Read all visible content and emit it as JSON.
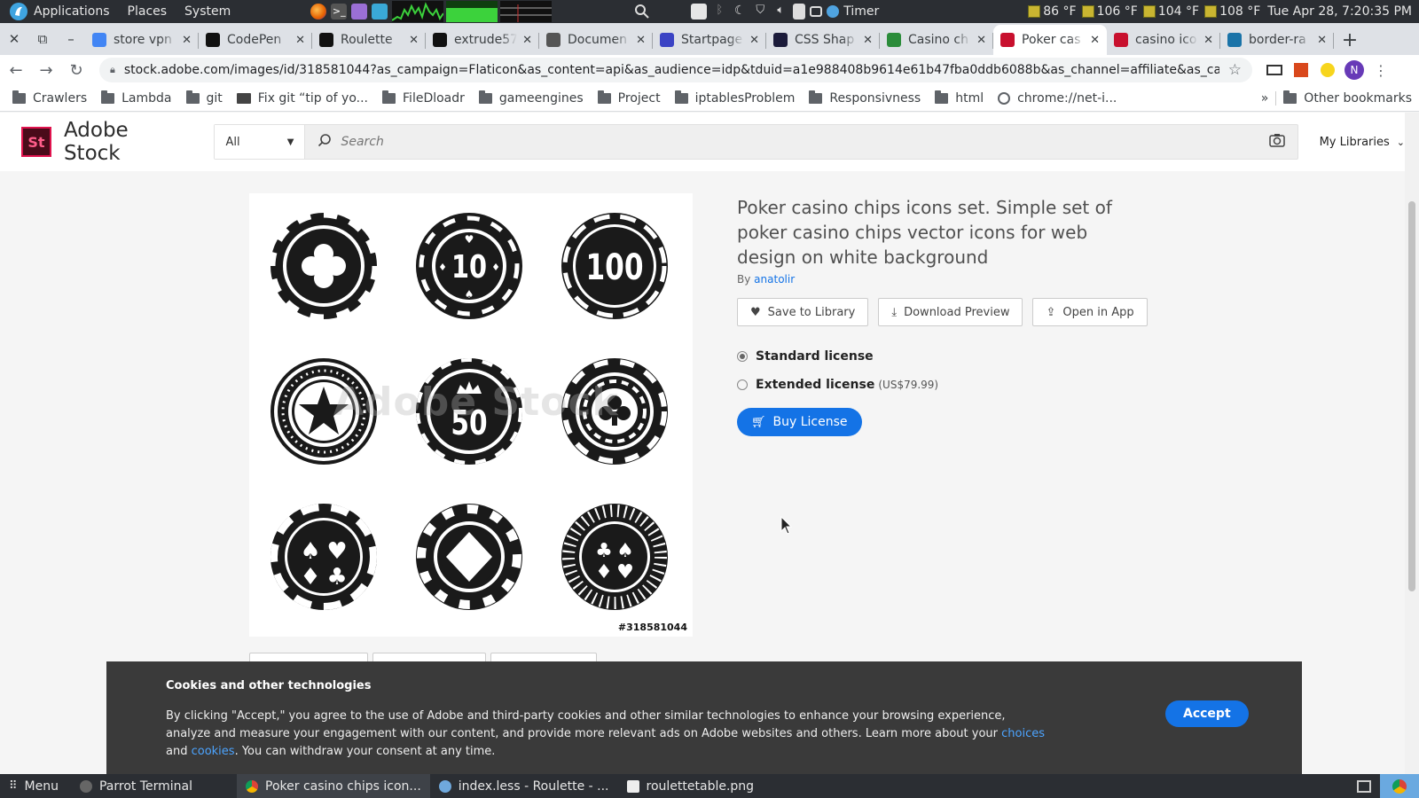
{
  "os_panel": {
    "menus": [
      "Applications",
      "Places",
      "System"
    ],
    "timer_label": "Timer",
    "weather": [
      "86 °F",
      "106 °F",
      "104 °F",
      "108 °F"
    ],
    "clock": "Tue Apr 28,  7:20:35 PM"
  },
  "tabs": [
    {
      "title": "store vpn",
      "icon": "google-icon",
      "color": "#4285f4"
    },
    {
      "title": "CodePen",
      "icon": "codepen-icon",
      "color": "#111111"
    },
    {
      "title": "Roulette",
      "icon": "codepen-icon",
      "color": "#111111"
    },
    {
      "title": "extrude57",
      "icon": "github-icon",
      "color": "#111111"
    },
    {
      "title": "Documen",
      "icon": "globe-icon",
      "color": "#555555"
    },
    {
      "title": "Startpage",
      "icon": "startpage-icon",
      "color": "#3b43c4"
    },
    {
      "title": "CSS Shap",
      "icon": "css-icon",
      "color": "#1b1b3a"
    },
    {
      "title": "Casino ch",
      "icon": "freepik-icon",
      "color": "#2b8c3a"
    },
    {
      "title": "Poker cas",
      "icon": "adobe-stock-icon",
      "color": "#c8102e",
      "active": true
    },
    {
      "title": "casino ico",
      "icon": "adobe-stock-icon",
      "color": "#c8102e"
    },
    {
      "title": "border-ra",
      "icon": "css-tricks-icon",
      "color": "#1a73a8"
    }
  ],
  "toolbar": {
    "url": "stock.adobe.com/images/id/318581044?as_campaign=Flaticon&as_content=api&as_audience=idp&tduid=a1e988408b9614e61b47fba0ddb6088b&as_channel=affiliate&as_campclass=redirect&...",
    "profile_initial": "N"
  },
  "bookmarks": [
    "Crawlers",
    "Lambda",
    "git",
    "Fix git “tip of yo...",
    "FileDloadr",
    "gameengines",
    "Project",
    "iptablesProblem",
    "Responsivness",
    "html",
    "chrome://net-i..."
  ],
  "bookmarks_overflow": "»",
  "bookmarks_other": "Other bookmarks",
  "header": {
    "logo": "St",
    "brand": "Adobe Stock",
    "category": "All",
    "search_placeholder": "Search",
    "libraries": "My Libraries"
  },
  "asset": {
    "title": "Poker casino chips icons set. Simple set of poker casino chips vector icons for web design on white background",
    "by_label": "By",
    "author": "anatolir",
    "id_label": "#318581044",
    "watermark": "Adobe Stock",
    "chips": [
      "clover",
      "10",
      "100",
      "star",
      "50",
      "club-ring",
      "suits",
      "diamond",
      "suits-ribbed"
    ]
  },
  "actions": {
    "save": "Save to Library",
    "download": "Download Preview",
    "open": "Open in App"
  },
  "licenses": {
    "standard": "Standard license",
    "extended": "Extended license",
    "extended_price": "(US$79.99)"
  },
  "buy_label": "Buy License",
  "cookie": {
    "title": "Cookies and other technologies",
    "text_1": "By clicking \"Accept,\" you agree to the use of Adobe and third-party cookies and other similar technologies to enhance your browsing experience, analyze and measure your engagement with our content, and provide more relevant ads on Adobe websites and others. Learn more about your ",
    "link_choices": "choices",
    "text_and": " and ",
    "link_cookies": "cookies",
    "text_2": ". You can withdraw your consent at any time.",
    "accept": "Accept"
  },
  "taskbar": {
    "menu": "Menu",
    "items": [
      "Parrot Terminal",
      "Poker casino chips icon...",
      "index.less - Roulette - ...",
      "roulettetable.png"
    ]
  }
}
